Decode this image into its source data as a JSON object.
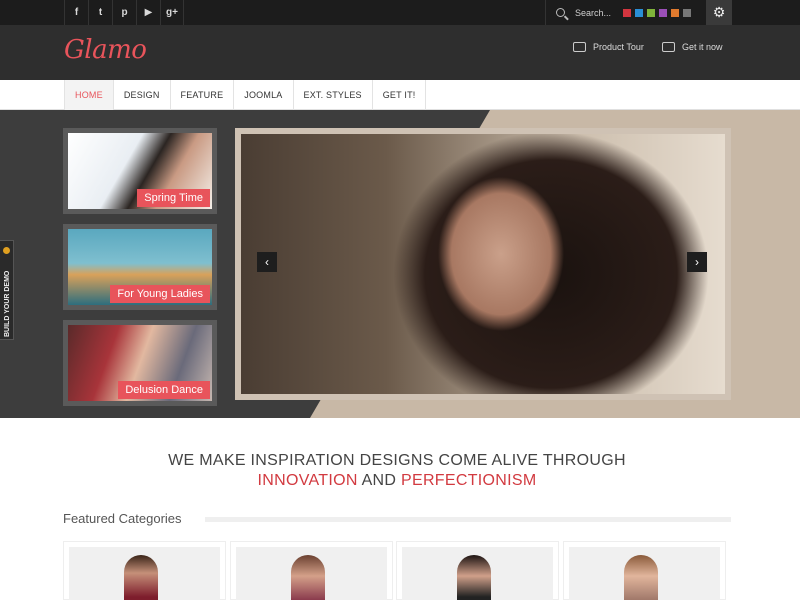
{
  "colors": {
    "accent": "#e8545b",
    "tagline_red": "#d23a40",
    "topbar": "#1c1c1c",
    "header": "#2e2e2e",
    "swatches": [
      "#d2353f",
      "#2a8fd6",
      "#7fb33a",
      "#9b4fb8",
      "#e07a2e",
      "#777777"
    ]
  },
  "social": {
    "icons": [
      "facebook-icon",
      "twitter-icon",
      "pinterest-icon",
      "youtube-icon",
      "google-plus-icon"
    ],
    "glyphs": [
      "f",
      "t",
      "p",
      "▶",
      "g+"
    ]
  },
  "search": {
    "placeholder": "Search..."
  },
  "header": {
    "logo": "Glamo",
    "links": [
      {
        "label": "Product Tour",
        "icon": "monitor-icon"
      },
      {
        "label": "Get it now",
        "icon": "basket-icon"
      }
    ]
  },
  "nav": {
    "items": [
      "HOME",
      "DESIGN",
      "FEATURE",
      "JOOMLA",
      "EXT. STYLES",
      "GET IT!"
    ],
    "active": "HOME"
  },
  "hero": {
    "side_tab": "BUILD YOUR DEMO",
    "thumbnails": [
      {
        "caption": "Spring Time"
      },
      {
        "caption": "For Young Ladies"
      },
      {
        "caption": "Delusion Dance"
      }
    ],
    "prev_arrow": "‹",
    "next_arrow": "›"
  },
  "tagline": {
    "line1": "WE MAKE INSPIRATION DESIGNS COME ALIVE THROUGH",
    "word1": "INNOVATION",
    "connector": " AND ",
    "word2": "PERFECTIONISM"
  },
  "featured": {
    "title": "Featured Categories",
    "cards": 4
  }
}
